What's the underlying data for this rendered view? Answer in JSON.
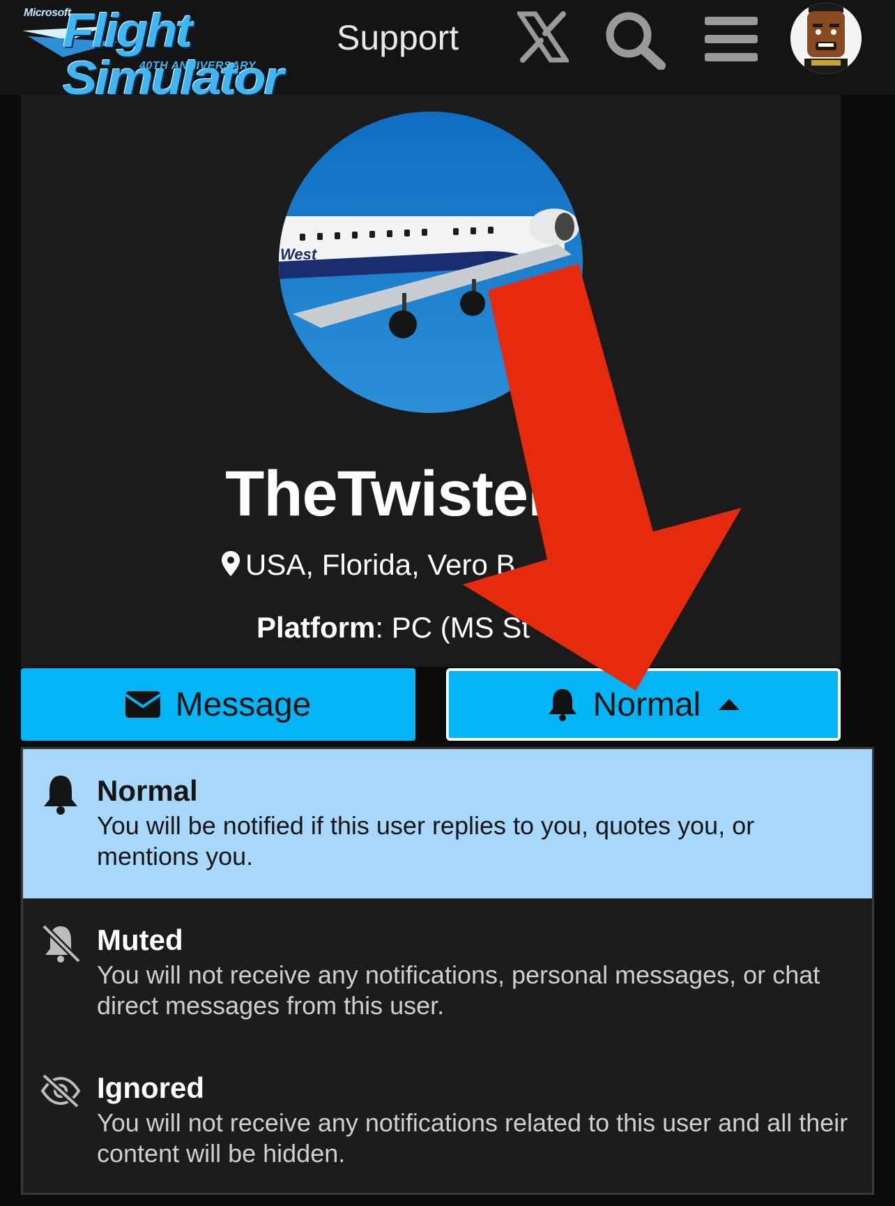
{
  "header": {
    "logo_brand": "Microsoft",
    "logo_title": "Flight Simulator",
    "logo_subtitle": "40TH ANNIVERSARY",
    "nav_support": "Support",
    "icons": [
      "x-logo-icon",
      "search-icon",
      "hamburger-menu-icon",
      "user-avatar"
    ]
  },
  "profile": {
    "username": "TheTwister7 6",
    "location": "USA, Florida, Vero B",
    "platform_label": "Platform",
    "platform_value": ": PC (MS St",
    "photo_livery_text": "West"
  },
  "actions": {
    "message_label": "Message",
    "notify_label": "Normal"
  },
  "dropdown": {
    "options": [
      {
        "title": "Normal",
        "description": "You will be notified if this user replies to you, quotes you, or mentions you.",
        "icon": "bell-icon",
        "selected": true
      },
      {
        "title": "Muted",
        "description": "You will not receive any notifications, personal messages, or chat direct messages from this user.",
        "icon": "bell-slash-icon",
        "selected": false
      },
      {
        "title": "Ignored",
        "description": "You will not receive any notifications related to this user and all their content will be hidden.",
        "icon": "eye-slash-icon",
        "selected": false
      }
    ]
  },
  "colors": {
    "accent": "#03b4f6",
    "selected_option": "#a7d8fb",
    "arrow": "#e62a0e",
    "background": "#0b0b0b",
    "card": "#1b1b1b"
  }
}
